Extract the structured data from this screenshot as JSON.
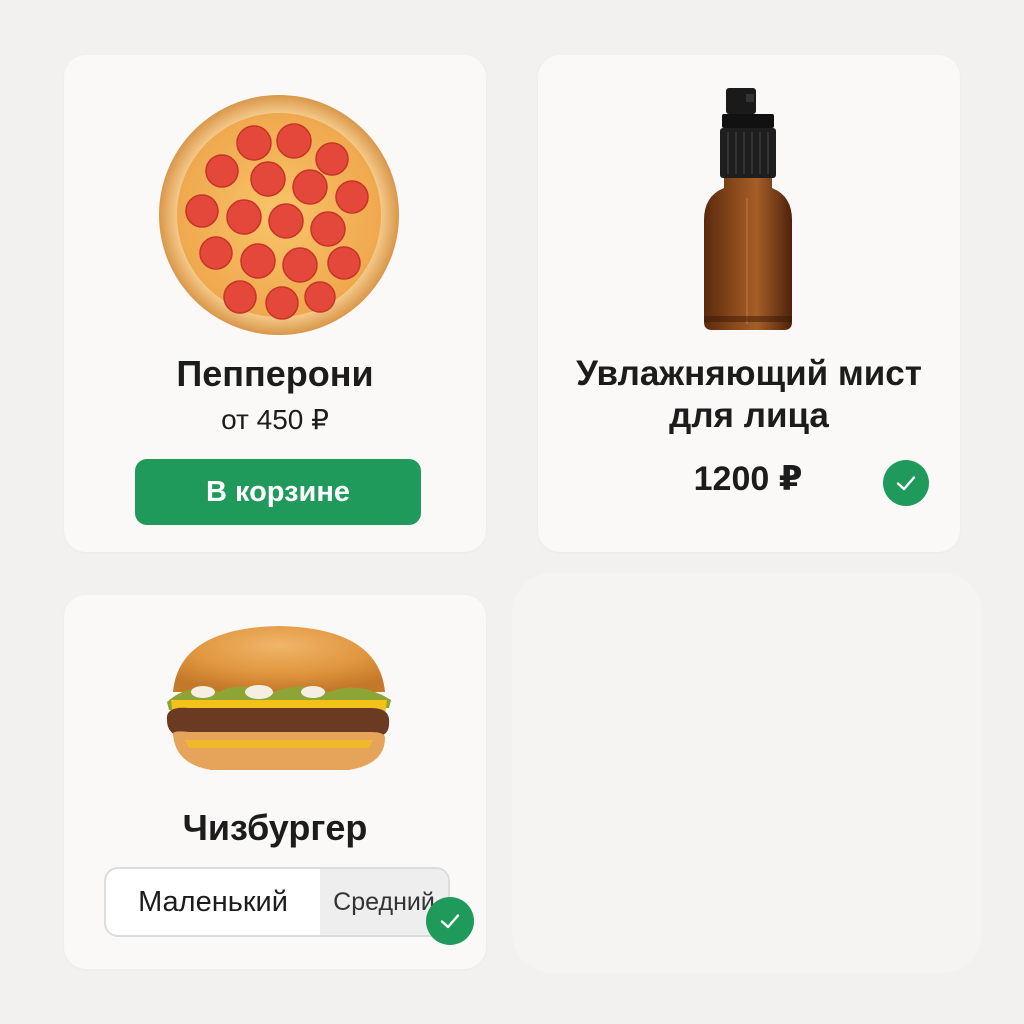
{
  "products": {
    "pizza": {
      "title": "Пепперони",
      "price": "от 450 ₽",
      "button_label": "В корзине",
      "image_icon": "pepperoni-pizza-image"
    },
    "mist": {
      "title_line1": "Увлажняющий мист",
      "title_line2": "для лица",
      "price": "1200 ₽",
      "status_icon": "check-icon",
      "image_icon": "spray-bottle-image"
    },
    "burger": {
      "title": "Чизбургер",
      "sizes": [
        "Маленький",
        "Средний"
      ],
      "selected_size": "Средний",
      "status_icon": "check-icon",
      "image_icon": "cheeseburger-image"
    }
  },
  "colors": {
    "accent": "#1f9a5b",
    "background": "#f2f1ef",
    "card": "#faf9f7"
  }
}
